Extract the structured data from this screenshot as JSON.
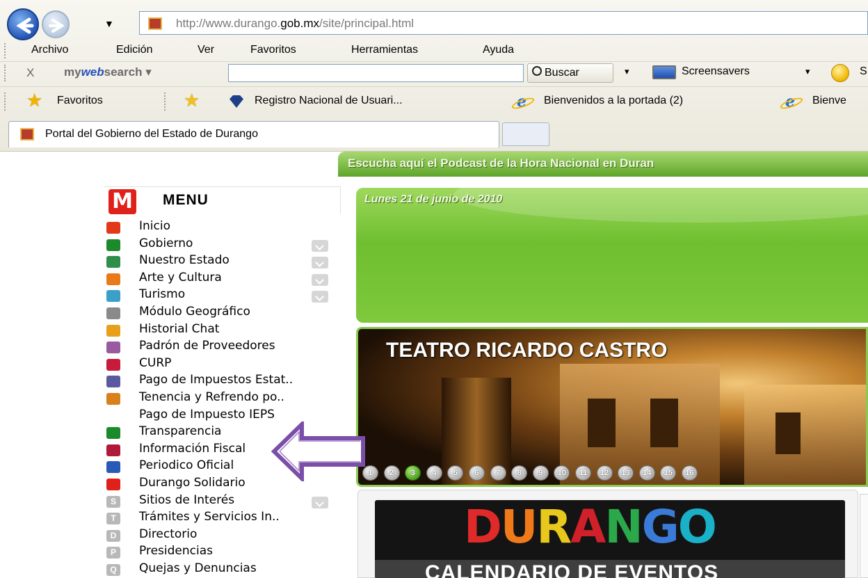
{
  "browser": {
    "address": {
      "prefix": "http://www.durango.",
      "domain": "gob.mx",
      "suffix": "/site/principal.html"
    },
    "history_dropdown": "▼",
    "menubar": [
      "Archivo",
      "Edición",
      "Ver",
      "Favoritos",
      "Herramientas",
      "Ayuda"
    ],
    "toolbar": {
      "close": "X",
      "brand_my": "my",
      "brand_web": "web",
      "brand_search": "search",
      "dropdown": "▾",
      "search_value": "",
      "buscar_label": "Buscar",
      "screensavers_label": "Screensavers",
      "cut_label": "S"
    },
    "favorites_bar": {
      "favorites_label": "Favoritos",
      "items": [
        "Registro Nacional de Usuari...",
        "Bienvenidos a la portada (2)",
        "Bienve"
      ]
    },
    "tab": {
      "title": "Portal del Gobierno del Estado de Durango"
    }
  },
  "page": {
    "podcast_text": "Escucha aquí  el Podcast de la Hora Nacional en Duran",
    "menu": {
      "logo_letter": "M",
      "title": "MENU",
      "items": [
        {
          "label": "Inicio",
          "icon": "home-icon",
          "color": "#e03a1a",
          "arrow": false
        },
        {
          "label": "Gobierno",
          "icon": "mexico-flag-icon",
          "color": "#1a8a2a",
          "arrow": true
        },
        {
          "label": "Nuestro Estado",
          "icon": "state-map-icon",
          "color": "#2e8e4a",
          "arrow": true
        },
        {
          "label": "Arte y Cultura",
          "icon": "palette-icon",
          "color": "#e87a1a",
          "arrow": true
        },
        {
          "label": "Turismo",
          "icon": "tree-icon",
          "color": "#3aa0c8",
          "arrow": true
        },
        {
          "label": "Módulo Geográfico",
          "icon": "globe-icon",
          "color": "#8a8a8a",
          "arrow": false
        },
        {
          "label": "Historial Chat",
          "icon": "chat-icon",
          "color": "#e8a01a",
          "arrow": false
        },
        {
          "label": "Padrón de Proveedores",
          "icon": "providers-icon",
          "color": "#9a5aa0",
          "arrow": false
        },
        {
          "label": "CURP",
          "icon": "curp-icon",
          "color": "#c81a3a",
          "arrow": false
        },
        {
          "label": "Pago de Impuestos Estat..",
          "icon": "at-icon",
          "color": "#5a5aa0",
          "arrow": false
        },
        {
          "label": "Tenencia y Refrendo  po..",
          "icon": "car-icon",
          "color": "#d8801a",
          "arrow": false
        },
        {
          "label": "Pago de Impuesto IEPS",
          "icon": "",
          "color": "",
          "arrow": false
        },
        {
          "label": "Transparencia",
          "icon": "magnifier-icon",
          "color": "#1a8a2a",
          "arrow": false
        },
        {
          "label": "Información Fiscal",
          "icon": "fiscal-icon",
          "color": "#b01a3a",
          "arrow": false
        },
        {
          "label": "Periodico Oficial",
          "icon": "newspaper-icon",
          "color": "#2a5ab8",
          "arrow": false
        },
        {
          "label": "Durango Solidario",
          "icon": "solidario-icon",
          "color": "#e0201a",
          "arrow": false
        },
        {
          "label": "Sitios de Interés",
          "icon": "letter-s-icon",
          "color": "#b8b8b8",
          "arrow": true,
          "letter": "S"
        },
        {
          "label": "Trámites y Servicios In..",
          "icon": "letter-t-icon",
          "color": "#b8b8b8",
          "arrow": false,
          "letter": "T"
        },
        {
          "label": "Directorio",
          "icon": "letter-d-icon",
          "color": "#b8b8b8",
          "arrow": false,
          "letter": "D"
        },
        {
          "label": "Presidencias",
          "icon": "letter-p-icon",
          "color": "#b8b8b8",
          "arrow": false,
          "letter": "P"
        },
        {
          "label": "Quejas y Denuncias",
          "icon": "letter-q-icon",
          "color": "#b8b8b8",
          "arrow": false,
          "letter": "Q"
        }
      ]
    },
    "date_text": "Lunes 21 de junio de 2010",
    "slider": {
      "title": "TEATRO RICARDO CASTRO",
      "pages": [
        "1",
        "2",
        "3",
        "4",
        "5",
        "6",
        "7",
        "8",
        "9",
        "10",
        "11",
        "12",
        "13",
        "14",
        "15",
        "16"
      ],
      "active_page": "3"
    },
    "event": {
      "durango_letters": [
        {
          "ch": "D",
          "color": "#e02a2a"
        },
        {
          "ch": "U",
          "color": "#f07a1a"
        },
        {
          "ch": "R",
          "color": "#e8c81a"
        },
        {
          "ch": "A",
          "color": "#d0202a"
        },
        {
          "ch": "N",
          "color": "#2aa84a"
        },
        {
          "ch": "G",
          "color": "#3a7ad8"
        },
        {
          "ch": "O",
          "color": "#1ab0c8"
        }
      ],
      "calendar_text": "CALENDARIO DE EVENTOS"
    },
    "annotation": {
      "arrow_color": "#7a4fa8",
      "target": "Información Fiscal"
    }
  }
}
